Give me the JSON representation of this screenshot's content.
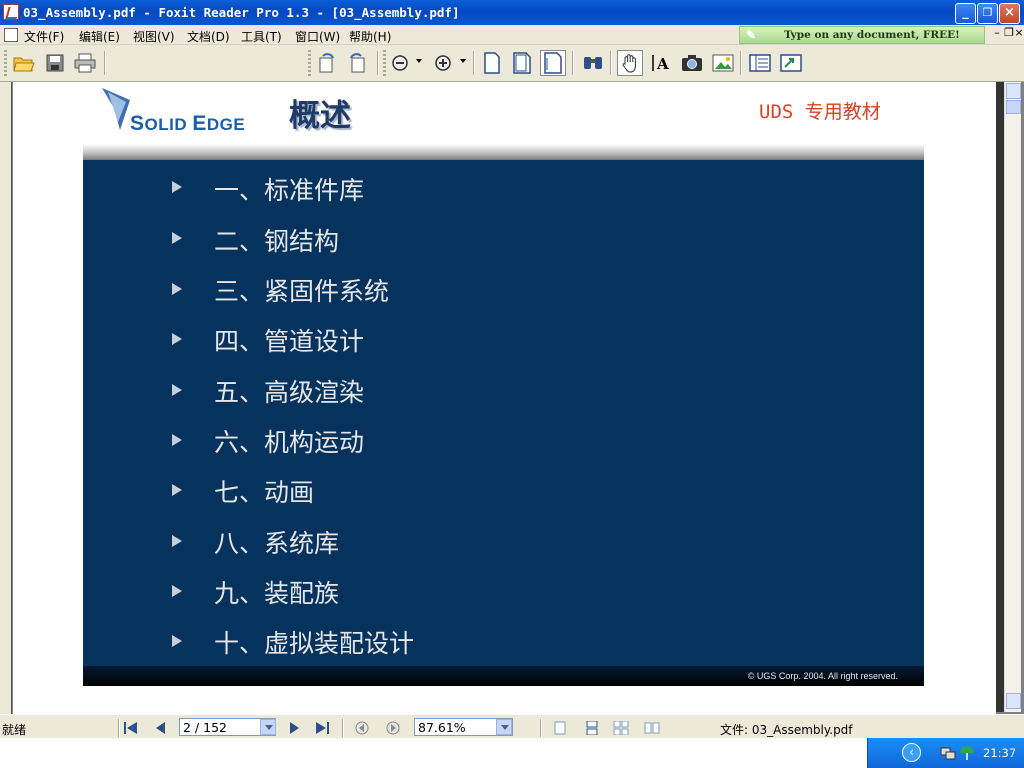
{
  "window": {
    "title": "03_Assembly.pdf - Foxit Reader Pro 1.3 - [03_Assembly.pdf]",
    "min_glyph": "_",
    "max_glyph": "❐",
    "close_glyph": "×"
  },
  "menu": {
    "items": [
      "文件(F)",
      "编辑(E)",
      "视图(V)",
      "文档(D)",
      "工具(T)",
      "窗口(W)",
      "帮助(H)"
    ],
    "ad_text": "Type on any document, FREE!",
    "mdi_min": "–",
    "mdi_restore": "❐",
    "mdi_close": "×"
  },
  "toolbar": {
    "icons": [
      "open-icon",
      "save-icon",
      "print-icon",
      "zoom-out-icon",
      "zoom-in-icon",
      "actual-size-icon",
      "fit-page-icon",
      "fit-width-icon",
      "find-icon",
      "hand-tool-icon",
      "select-text-icon",
      "snapshot-icon",
      "image-tool-icon",
      "bookmark-pane-icon",
      "typewriter-icon"
    ]
  },
  "slide": {
    "logo_text_first": "S",
    "logo_text_rest": "OLID ",
    "logo_text_second": "E",
    "logo_text_rest2": "DGE",
    "title": "概述",
    "tag": "UDS 专用教材",
    "items": [
      "一、标准件库",
      "二、钢结构",
      "三、紧固件系统",
      "四、管道设计",
      "五、高级渲染",
      "六、机构运动",
      "七、动画",
      "八、系统库",
      "九、装配族",
      "十、虚拟装配设计"
    ],
    "copyright": "© UGS Corp. 2004. All right reserved."
  },
  "status": {
    "ready": "就绪",
    "page_value": "2 / 152",
    "zoom_value": "87.61%",
    "file_label": "文件: 03_Assembly.pdf"
  },
  "taskbar": {
    "time": "21:37",
    "chevron": "‹"
  },
  "colors": {
    "titlebar": "#0a57d0",
    "slide_body": "#05335e",
    "slide_title": "#1e3a66",
    "tag_red": "#d4432a",
    "logo_blue": "#1b5fa8"
  }
}
